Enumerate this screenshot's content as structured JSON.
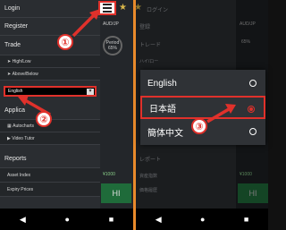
{
  "left_menu": {
    "items": [
      {
        "label": "Login"
      },
      {
        "label": "Register"
      },
      {
        "label": "Trade"
      },
      {
        "label": "High/Low",
        "sub": true
      },
      {
        "label": "Above/Below",
        "sub": true
      }
    ],
    "language_select": {
      "value": "English"
    },
    "items2": [
      {
        "label": "Applica"
      },
      {
        "label": "Autocharts",
        "sub": true
      },
      {
        "label": "Video Tutor",
        "sub": true
      },
      {
        "label": "Reports"
      },
      {
        "label": "Asset Index",
        "sub": true
      },
      {
        "label": "Expiry Prices",
        "sub": true
      }
    ],
    "bg_text": {
      "pair": "AUD/JP",
      "period": "Period",
      "pct": "65%",
      "amount": "¥1000",
      "btn": "HI"
    }
  },
  "right_bg": {
    "items": [
      "ログイン",
      "登録",
      "トレード",
      "ハイ/ロー",
      "レポート",
      "資産指数",
      "価格履歴"
    ],
    "pair": "AUD/JP",
    "pct": "65%",
    "amount": "¥1000",
    "btn": "HI"
  },
  "language_dialog": {
    "options": [
      {
        "label": "English",
        "selected": false
      },
      {
        "label": "日本語",
        "selected": true
      },
      {
        "label": "簡体中文",
        "selected": false
      }
    ]
  },
  "callouts": [
    "①",
    "②",
    "③"
  ],
  "navbar": {
    "back": "◀",
    "home": "●",
    "recent": "■"
  },
  "colors": {
    "accent": "#e0312b",
    "divider": "#e98a2b"
  }
}
